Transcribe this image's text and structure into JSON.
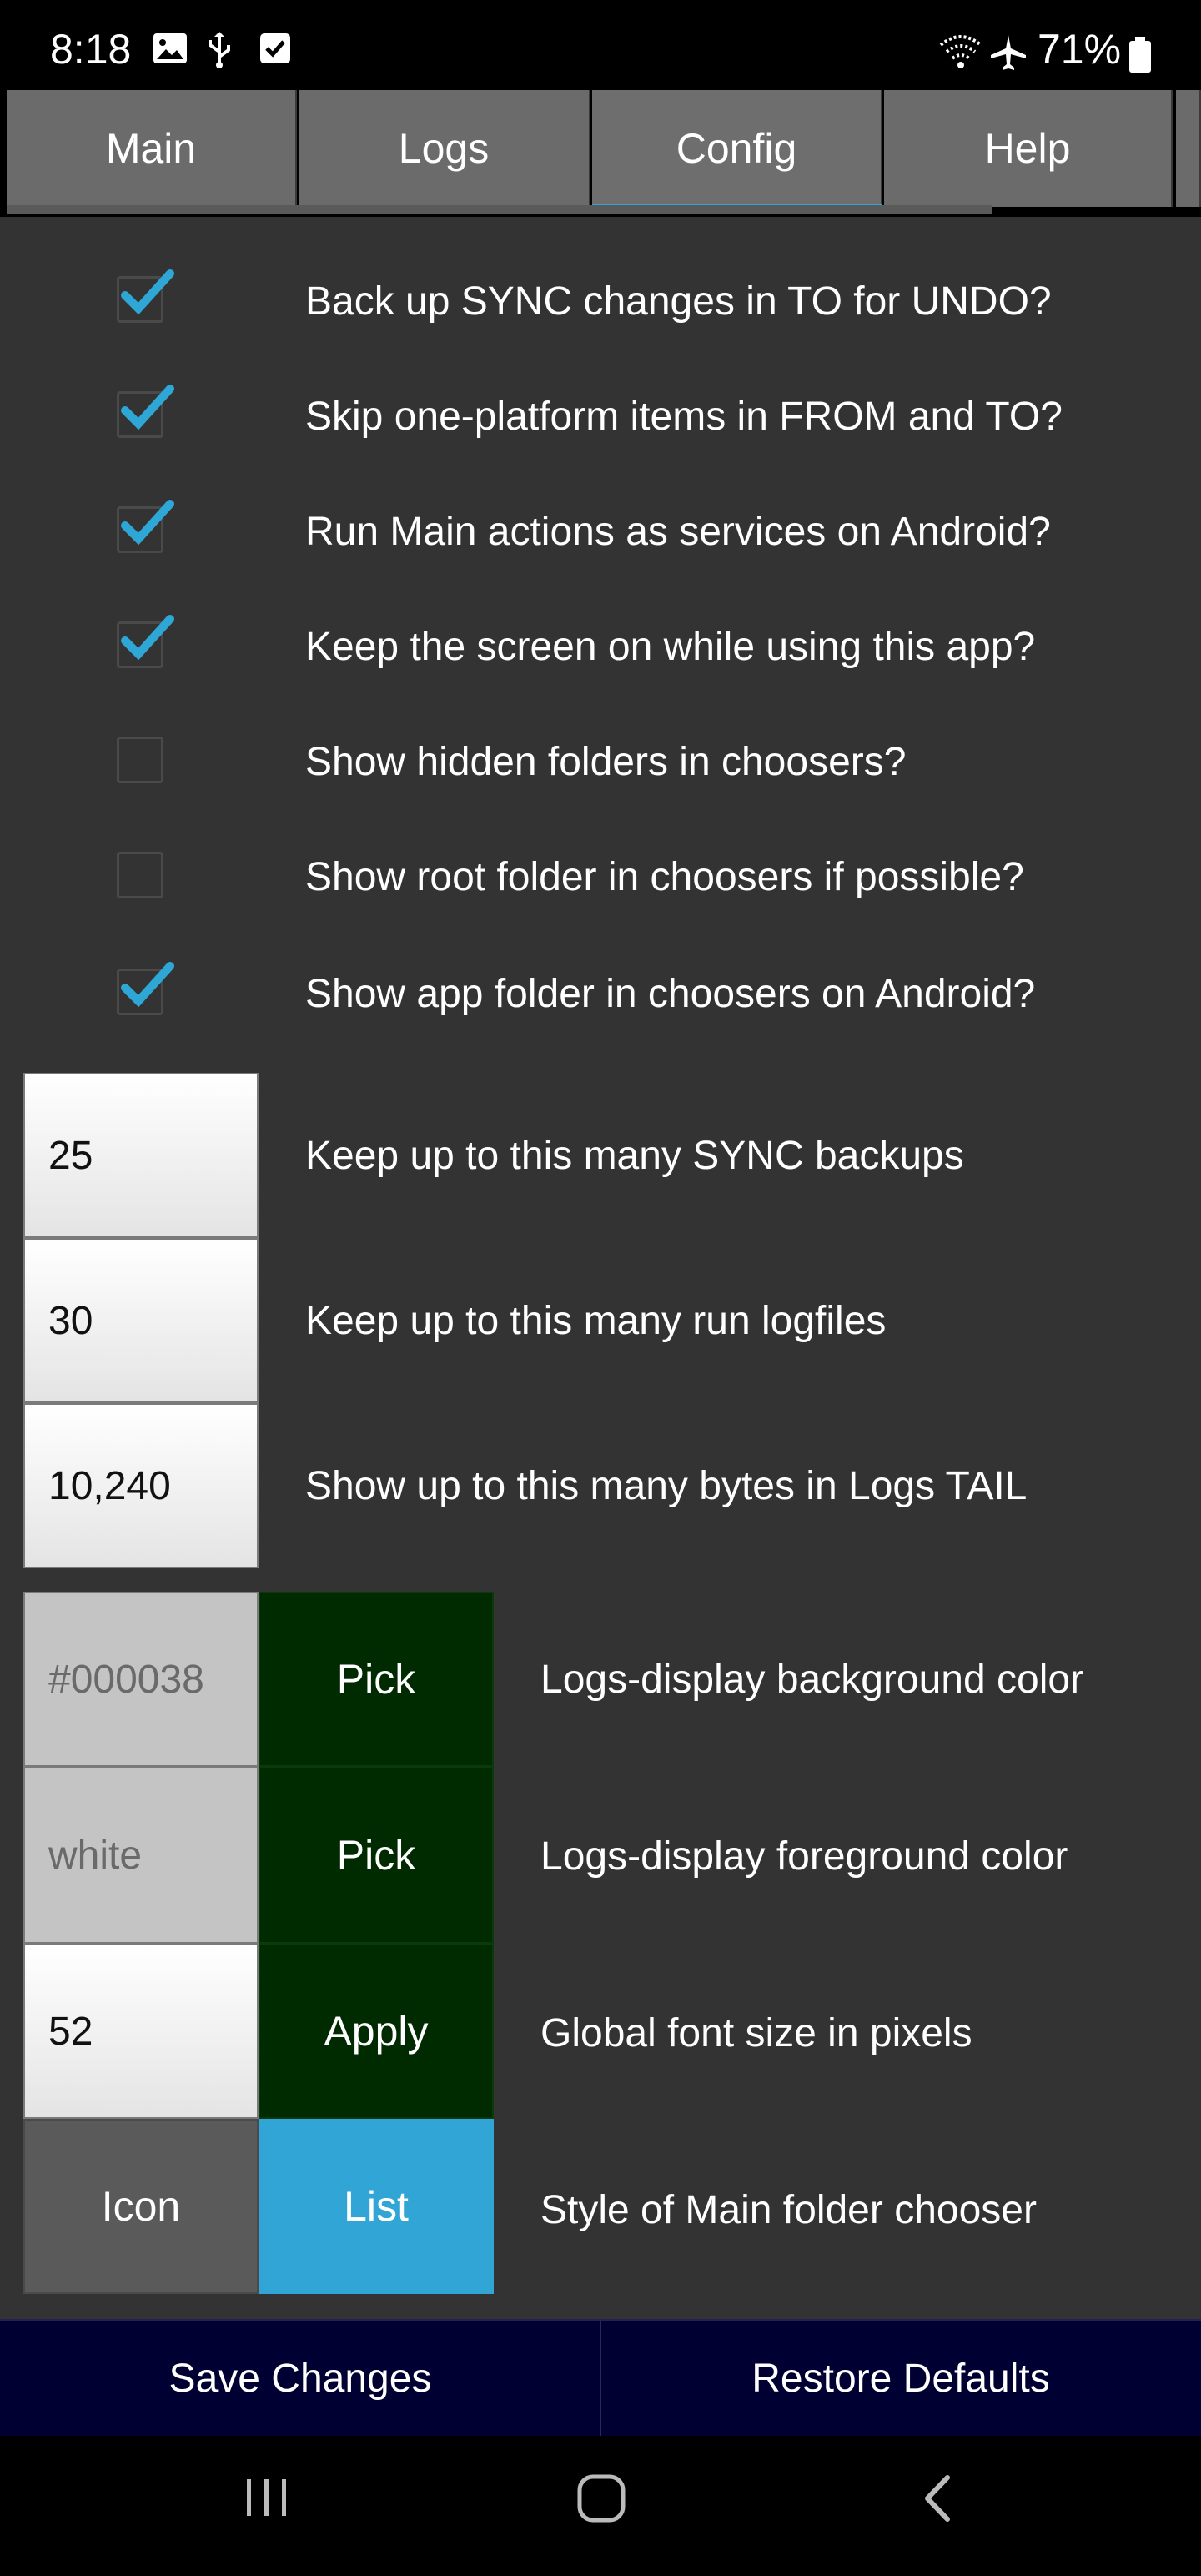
{
  "status_bar": {
    "time": "8:18",
    "battery_text": "71%",
    "left_icons": [
      "image-icon",
      "usb-icon",
      "checkbox-notification-icon"
    ],
    "right_icons": [
      "wifi-icon",
      "airplane-icon",
      "battery-icon"
    ]
  },
  "tabs": [
    {
      "label": "Main",
      "active": false
    },
    {
      "label": "Logs",
      "active": false
    },
    {
      "label": "Config",
      "active": true
    },
    {
      "label": "Help",
      "active": false
    }
  ],
  "checkbox_options": [
    {
      "label": "Back up SYNC changes in TO for UNDO?",
      "checked": true
    },
    {
      "label": "Skip one-platform items in FROM and TO?",
      "checked": true
    },
    {
      "label": "Run Main actions as services on Android?",
      "checked": true
    },
    {
      "label": "Keep the screen on while using this app?",
      "checked": true
    },
    {
      "label": "Show hidden folders in choosers?",
      "checked": false
    },
    {
      "label": "Show root folder in choosers if possible?",
      "checked": false
    },
    {
      "label": "Show app folder in choosers on Android?",
      "checked": true
    }
  ],
  "numeric_settings": [
    {
      "value": "25",
      "label": "Keep up to this many SYNC backups"
    },
    {
      "value": "30",
      "label": "Keep up to this many run logfiles"
    },
    {
      "value": "10,240",
      "label": "Show up to this many bytes in Logs TAIL"
    }
  ],
  "color_settings": [
    {
      "value": "#000038",
      "button": "Pick",
      "label": "Logs-display background color"
    },
    {
      "value": "white",
      "button": "Pick",
      "label": "Logs-display foreground color"
    }
  ],
  "font_setting": {
    "value": "52",
    "button": "Apply",
    "label": "Global font size in pixels"
  },
  "chooser_style": {
    "option_a": "Icon",
    "option_b": "List",
    "selected": "List",
    "label": "Style of Main folder chooser"
  },
  "bottom_buttons": {
    "save": "Save Changes",
    "restore": "Restore Defaults"
  },
  "colors": {
    "background": "#333333",
    "tab_bg": "#6b6b6b",
    "accent_blue": "#30a5d6",
    "dark_green": "#002a00",
    "bottom_bar": "#000033",
    "checkmark": "#2ea6d6"
  }
}
